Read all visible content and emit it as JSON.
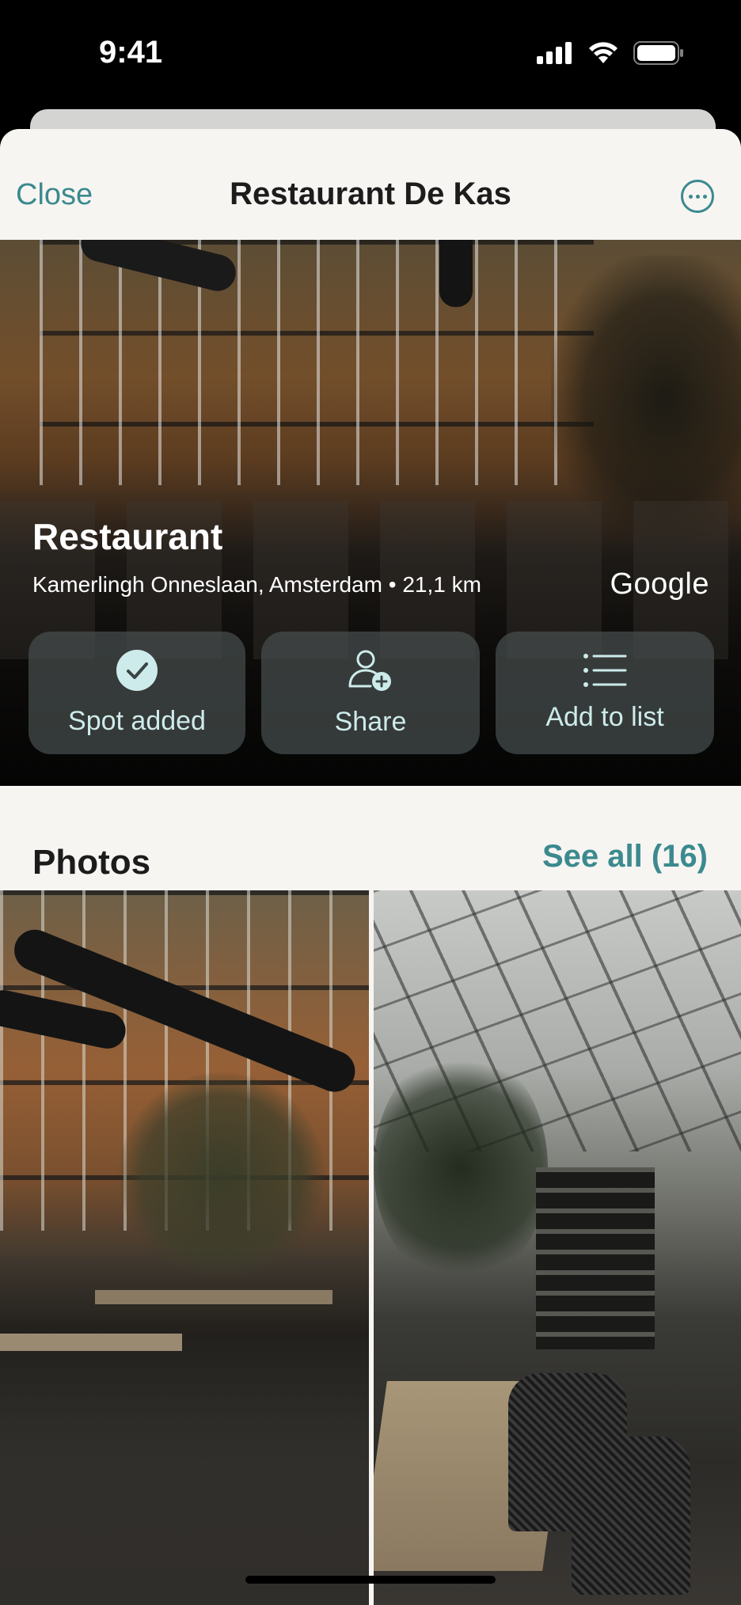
{
  "status_bar": {
    "time": "9:41"
  },
  "nav": {
    "close_label": "Close",
    "title": "Restaurant De Kas"
  },
  "place": {
    "category": "Restaurant",
    "address_line": "Kamerlingh Onneslaan, Amsterdam • 21,1 km",
    "provider": "Google"
  },
  "actions": [
    {
      "label": "Spot added",
      "icon": "check-circle-icon"
    },
    {
      "label": "Share",
      "icon": "person-add-icon"
    },
    {
      "label": "Add to list",
      "icon": "list-icon"
    }
  ],
  "photos": {
    "title": "Photos",
    "see_all_label": "See all (16)"
  },
  "colors": {
    "accent": "#3b8a8f",
    "sheet_bg": "#f7f5f2",
    "action_label": "#cdebea"
  }
}
